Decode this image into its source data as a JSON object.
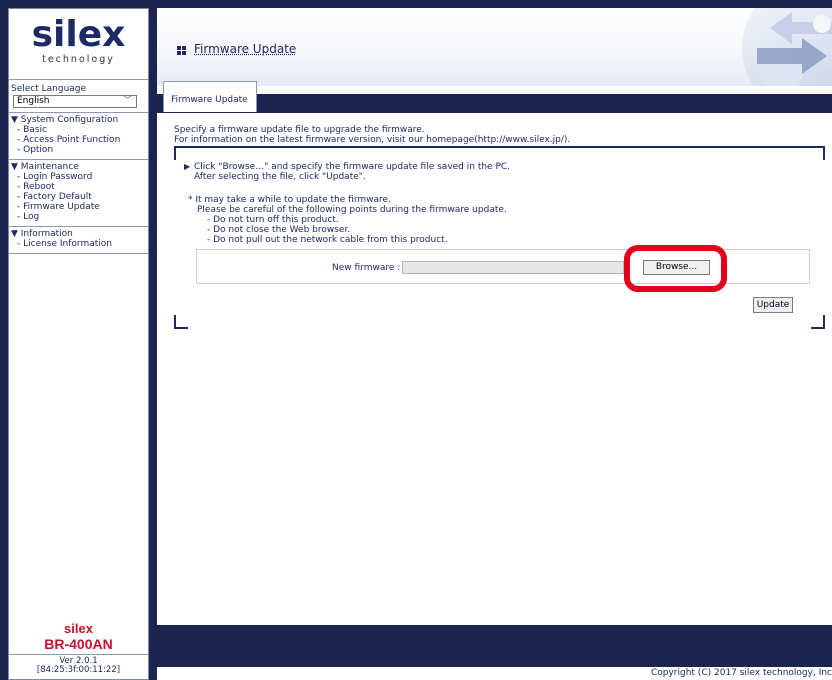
{
  "brand": {
    "logo_text": "silex",
    "logo_sub": "technology",
    "model_brand": "silex",
    "model_name": "BR-400AN",
    "version": "Ver 2.0.1",
    "mac": "[84:25:3f:00:11:22]"
  },
  "language": {
    "label": "Select Language",
    "selected": "English"
  },
  "sidebar": {
    "sections": [
      {
        "header": "▼ System Configuration",
        "items": [
          "- Basic",
          "- Access Point Function",
          "- Option"
        ]
      },
      {
        "header": "▼ Maintenance",
        "items": [
          "- Login Password",
          "- Reboot",
          "- Factory Default",
          "- Firmware Update",
          "- Log"
        ]
      },
      {
        "header": "▼ Information",
        "items": [
          "- License Information"
        ]
      }
    ]
  },
  "page": {
    "title": "Firmware Update",
    "tab": "Firmware Update",
    "intro_1": "Specify a firmware update file to upgrade the firmware.",
    "intro_2": "For information on the latest firmware version, visit our homepage(http://www.silex.jp/).",
    "instr_1": "Click \"Browse…\" and specify the firmware update file saved in the PC.",
    "instr_2": "After selecting the file, click \"Update\".",
    "note_1": "* It may take a while to update the firmware.",
    "note_2": "Please be careful of the following points during the firmware update.",
    "note_3": "- Do not turn off this product.",
    "note_4": "- Do not close the Web browser.",
    "note_5": "- Do not pull out the network cable from this product.",
    "fw_label": "New firmware :",
    "fw_value": "",
    "browse_label": "Browse...",
    "update_label": "Update"
  },
  "footer": {
    "copyright": "Copyright (C) 2017 silex technology, Inc"
  },
  "colors": {
    "navy": "#1b2450",
    "text_navy": "#1d2a66",
    "highlight_red": "#e3001b",
    "model_red": "#c8102e"
  }
}
